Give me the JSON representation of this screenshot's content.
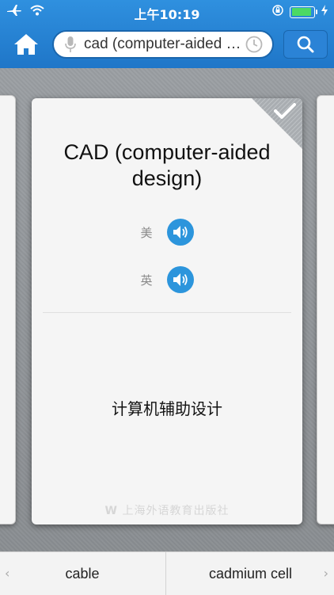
{
  "status_bar": {
    "time": "上午10:19"
  },
  "search": {
    "query": "cad (computer-aided design)"
  },
  "card": {
    "word": "CAD (computer-aided design)",
    "pronunciations": [
      {
        "label": "美"
      },
      {
        "label": "英"
      }
    ],
    "meaning": "计算机辅助设计",
    "publisher": "上海外语教育出版社"
  },
  "bottom_nav": {
    "prev_label": "cable",
    "next_label": "cadmium cell"
  },
  "colors": {
    "header_blue": "#2585d7",
    "speaker_blue": "#2c95dc",
    "battery_green": "#4cd964"
  }
}
